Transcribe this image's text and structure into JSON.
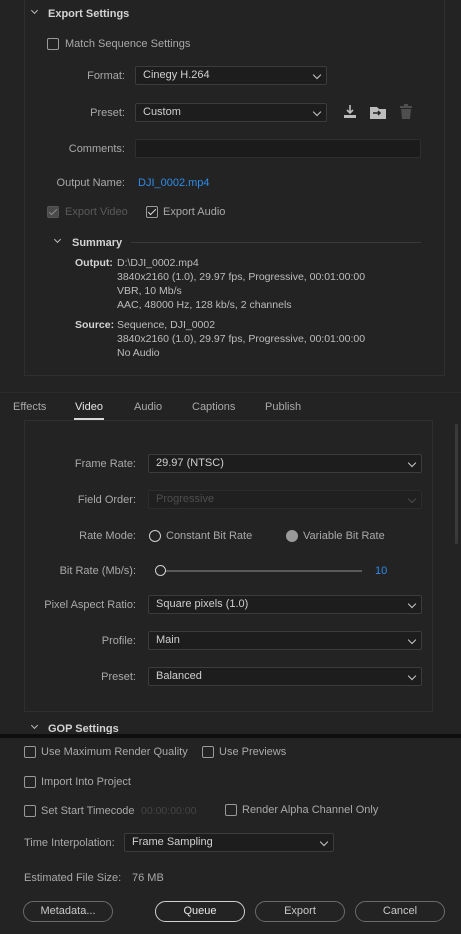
{
  "export_settings": {
    "section_title": "Export Settings",
    "match_sequence_label": "Match Sequence Settings",
    "format_label": "Format:",
    "format_value": "Cinegy H.264",
    "preset_label": "Preset:",
    "preset_value": "Custom",
    "comments_label": "Comments:",
    "comments_value": "",
    "output_name_label": "Output Name:",
    "output_name_value": "DJI_0002.mp4",
    "export_video_label": "Export Video",
    "export_audio_label": "Export Audio",
    "summary": {
      "title": "Summary",
      "output_label": "Output:",
      "output_lines": [
        "D:\\DJI_0002.mp4",
        "3840x2160 (1.0), 29.97 fps, Progressive, 00:01:00:00",
        "VBR, 10 Mb/s",
        "AAC, 48000 Hz, 128 kb/s, 2 channels"
      ],
      "source_label": "Source:",
      "source_lines": [
        "Sequence, DJI_0002",
        "3840x2160 (1.0), 29.97 fps, Progressive, 00:01:00:00",
        "No Audio"
      ]
    }
  },
  "tabs": [
    {
      "label": "Effects",
      "active": false
    },
    {
      "label": "Video",
      "active": true
    },
    {
      "label": "Audio",
      "active": false
    },
    {
      "label": "Captions",
      "active": false
    },
    {
      "label": "Publish",
      "active": false
    }
  ],
  "video": {
    "frame_rate_label": "Frame Rate:",
    "frame_rate_value": "29.97 (NTSC)",
    "field_order_label": "Field Order:",
    "field_order_value": "Progressive",
    "rate_mode_label": "Rate Mode:",
    "rate_mode_cbr": "Constant Bit Rate",
    "rate_mode_vbr": "Variable Bit Rate",
    "bit_rate_label": "Bit Rate (Mb/s):",
    "bit_rate_value": "10",
    "bit_rate_fraction": 0.0,
    "pixel_aspect_label": "Pixel Aspect Ratio:",
    "pixel_aspect_value": "Square pixels (1.0)",
    "profile_label": "Profile:",
    "profile_value": "Main",
    "preset_label": "Preset:",
    "preset_value": "Balanced",
    "gop_title": "GOP Settings"
  },
  "bottom": {
    "max_render_label": "Use Maximum Render Quality",
    "use_previews_label": "Use Previews",
    "import_project_label": "Import Into Project",
    "set_start_tc_label": "Set Start Timecode",
    "start_tc_value": "00:00:00:00",
    "render_alpha_label": "Render Alpha Channel Only",
    "time_interp_label": "Time Interpolation:",
    "time_interp_value": "Frame Sampling",
    "est_size_label": "Estimated File Size:",
    "est_size_value": "76 MB",
    "metadata_btn": "Metadata...",
    "queue_btn": "Queue",
    "export_btn": "Export",
    "cancel_btn": "Cancel"
  },
  "colors": {
    "accent_link": "#2d8ceb",
    "background": "#232323"
  },
  "icons": [
    "chevron-down-icon",
    "save-preset-icon",
    "import-preset-icon",
    "trash-icon"
  ]
}
